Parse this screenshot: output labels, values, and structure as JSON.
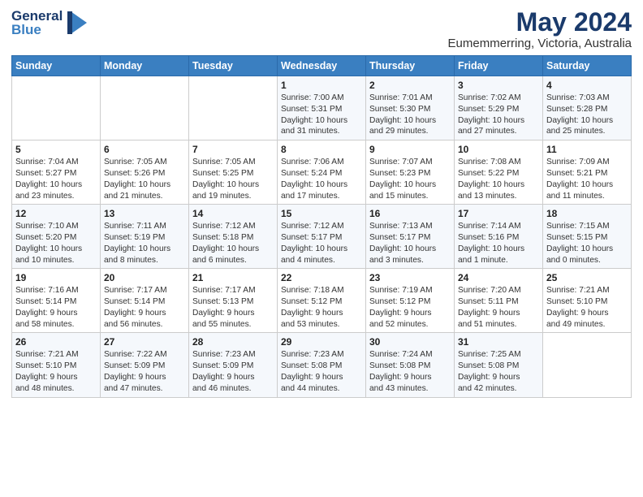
{
  "logo": {
    "general": "General",
    "blue": "Blue"
  },
  "header": {
    "title": "May 2024",
    "subtitle": "Eumemmerring, Victoria, Australia"
  },
  "weekdays": [
    "Sunday",
    "Monday",
    "Tuesday",
    "Wednesday",
    "Thursday",
    "Friday",
    "Saturday"
  ],
  "weeks": [
    [
      {
        "day": "",
        "sunrise": "",
        "sunset": "",
        "daylight": ""
      },
      {
        "day": "",
        "sunrise": "",
        "sunset": "",
        "daylight": ""
      },
      {
        "day": "",
        "sunrise": "",
        "sunset": "",
        "daylight": ""
      },
      {
        "day": "1",
        "sunrise": "Sunrise: 7:00 AM",
        "sunset": "Sunset: 5:31 PM",
        "daylight": "Daylight: 10 hours and 31 minutes."
      },
      {
        "day": "2",
        "sunrise": "Sunrise: 7:01 AM",
        "sunset": "Sunset: 5:30 PM",
        "daylight": "Daylight: 10 hours and 29 minutes."
      },
      {
        "day": "3",
        "sunrise": "Sunrise: 7:02 AM",
        "sunset": "Sunset: 5:29 PM",
        "daylight": "Daylight: 10 hours and 27 minutes."
      },
      {
        "day": "4",
        "sunrise": "Sunrise: 7:03 AM",
        "sunset": "Sunset: 5:28 PM",
        "daylight": "Daylight: 10 hours and 25 minutes."
      }
    ],
    [
      {
        "day": "5",
        "sunrise": "Sunrise: 7:04 AM",
        "sunset": "Sunset: 5:27 PM",
        "daylight": "Daylight: 10 hours and 23 minutes."
      },
      {
        "day": "6",
        "sunrise": "Sunrise: 7:05 AM",
        "sunset": "Sunset: 5:26 PM",
        "daylight": "Daylight: 10 hours and 21 minutes."
      },
      {
        "day": "7",
        "sunrise": "Sunrise: 7:05 AM",
        "sunset": "Sunset: 5:25 PM",
        "daylight": "Daylight: 10 hours and 19 minutes."
      },
      {
        "day": "8",
        "sunrise": "Sunrise: 7:06 AM",
        "sunset": "Sunset: 5:24 PM",
        "daylight": "Daylight: 10 hours and 17 minutes."
      },
      {
        "day": "9",
        "sunrise": "Sunrise: 7:07 AM",
        "sunset": "Sunset: 5:23 PM",
        "daylight": "Daylight: 10 hours and 15 minutes."
      },
      {
        "day": "10",
        "sunrise": "Sunrise: 7:08 AM",
        "sunset": "Sunset: 5:22 PM",
        "daylight": "Daylight: 10 hours and 13 minutes."
      },
      {
        "day": "11",
        "sunrise": "Sunrise: 7:09 AM",
        "sunset": "Sunset: 5:21 PM",
        "daylight": "Daylight: 10 hours and 11 minutes."
      }
    ],
    [
      {
        "day": "12",
        "sunrise": "Sunrise: 7:10 AM",
        "sunset": "Sunset: 5:20 PM",
        "daylight": "Daylight: 10 hours and 10 minutes."
      },
      {
        "day": "13",
        "sunrise": "Sunrise: 7:11 AM",
        "sunset": "Sunset: 5:19 PM",
        "daylight": "Daylight: 10 hours and 8 minutes."
      },
      {
        "day": "14",
        "sunrise": "Sunrise: 7:12 AM",
        "sunset": "Sunset: 5:18 PM",
        "daylight": "Daylight: 10 hours and 6 minutes."
      },
      {
        "day": "15",
        "sunrise": "Sunrise: 7:12 AM",
        "sunset": "Sunset: 5:17 PM",
        "daylight": "Daylight: 10 hours and 4 minutes."
      },
      {
        "day": "16",
        "sunrise": "Sunrise: 7:13 AM",
        "sunset": "Sunset: 5:17 PM",
        "daylight": "Daylight: 10 hours and 3 minutes."
      },
      {
        "day": "17",
        "sunrise": "Sunrise: 7:14 AM",
        "sunset": "Sunset: 5:16 PM",
        "daylight": "Daylight: 10 hours and 1 minute."
      },
      {
        "day": "18",
        "sunrise": "Sunrise: 7:15 AM",
        "sunset": "Sunset: 5:15 PM",
        "daylight": "Daylight: 10 hours and 0 minutes."
      }
    ],
    [
      {
        "day": "19",
        "sunrise": "Sunrise: 7:16 AM",
        "sunset": "Sunset: 5:14 PM",
        "daylight": "Daylight: 9 hours and 58 minutes."
      },
      {
        "day": "20",
        "sunrise": "Sunrise: 7:17 AM",
        "sunset": "Sunset: 5:14 PM",
        "daylight": "Daylight: 9 hours and 56 minutes."
      },
      {
        "day": "21",
        "sunrise": "Sunrise: 7:17 AM",
        "sunset": "Sunset: 5:13 PM",
        "daylight": "Daylight: 9 hours and 55 minutes."
      },
      {
        "day": "22",
        "sunrise": "Sunrise: 7:18 AM",
        "sunset": "Sunset: 5:12 PM",
        "daylight": "Daylight: 9 hours and 53 minutes."
      },
      {
        "day": "23",
        "sunrise": "Sunrise: 7:19 AM",
        "sunset": "Sunset: 5:12 PM",
        "daylight": "Daylight: 9 hours and 52 minutes."
      },
      {
        "day": "24",
        "sunrise": "Sunrise: 7:20 AM",
        "sunset": "Sunset: 5:11 PM",
        "daylight": "Daylight: 9 hours and 51 minutes."
      },
      {
        "day": "25",
        "sunrise": "Sunrise: 7:21 AM",
        "sunset": "Sunset: 5:10 PM",
        "daylight": "Daylight: 9 hours and 49 minutes."
      }
    ],
    [
      {
        "day": "26",
        "sunrise": "Sunrise: 7:21 AM",
        "sunset": "Sunset: 5:10 PM",
        "daylight": "Daylight: 9 hours and 48 minutes."
      },
      {
        "day": "27",
        "sunrise": "Sunrise: 7:22 AM",
        "sunset": "Sunset: 5:09 PM",
        "daylight": "Daylight: 9 hours and 47 minutes."
      },
      {
        "day": "28",
        "sunrise": "Sunrise: 7:23 AM",
        "sunset": "Sunset: 5:09 PM",
        "daylight": "Daylight: 9 hours and 46 minutes."
      },
      {
        "day": "29",
        "sunrise": "Sunrise: 7:23 AM",
        "sunset": "Sunset: 5:08 PM",
        "daylight": "Daylight: 9 hours and 44 minutes."
      },
      {
        "day": "30",
        "sunrise": "Sunrise: 7:24 AM",
        "sunset": "Sunset: 5:08 PM",
        "daylight": "Daylight: 9 hours and 43 minutes."
      },
      {
        "day": "31",
        "sunrise": "Sunrise: 7:25 AM",
        "sunset": "Sunset: 5:08 PM",
        "daylight": "Daylight: 9 hours and 42 minutes."
      },
      {
        "day": "",
        "sunrise": "",
        "sunset": "",
        "daylight": ""
      }
    ]
  ]
}
